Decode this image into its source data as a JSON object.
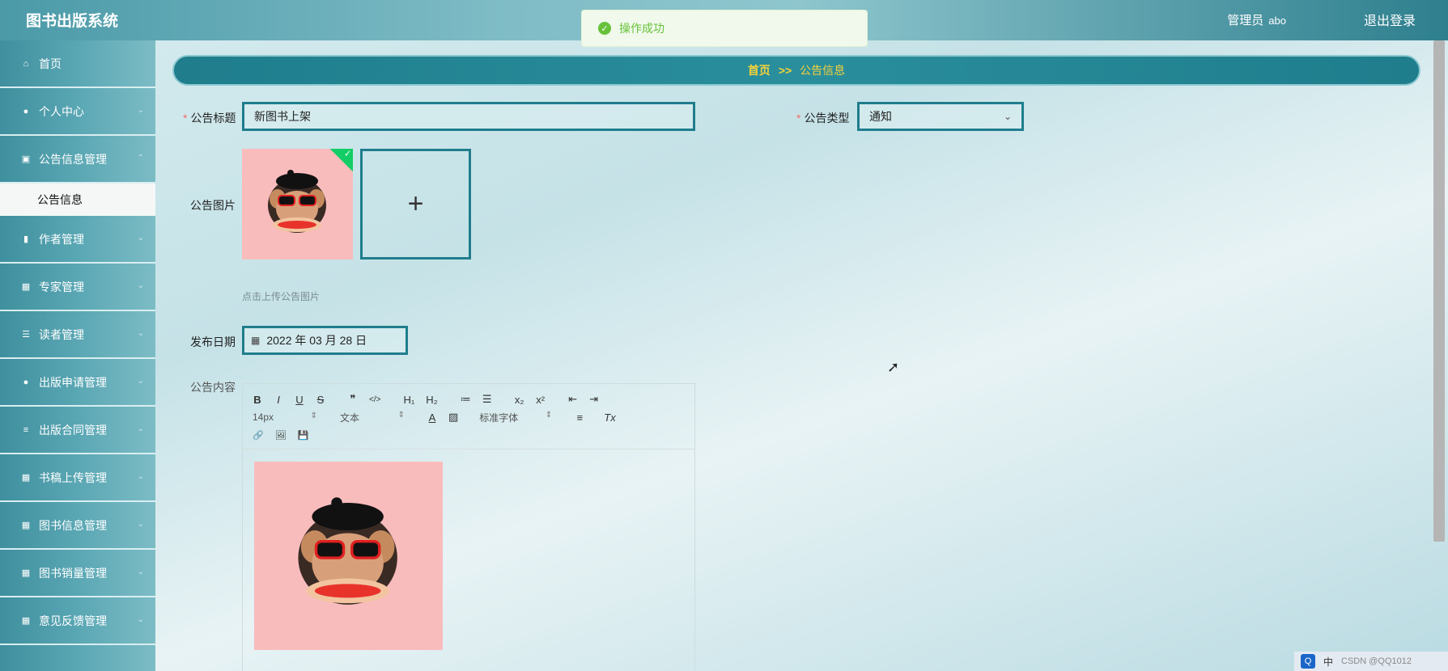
{
  "header": {
    "title": "图书出版系统",
    "user_role": "管理员",
    "user_name": "abo",
    "logout_label": "退出登录"
  },
  "toast": {
    "message": "操作成功"
  },
  "sidebar": {
    "items": [
      {
        "label": "首页",
        "icon": "home-icon"
      },
      {
        "label": "个人中心",
        "icon": "user-icon"
      },
      {
        "label": "公告信息管理",
        "icon": "chart-icon"
      },
      {
        "label": "公告信息",
        "sub": true
      },
      {
        "label": "作者管理",
        "icon": "bar-chart-icon"
      },
      {
        "label": "专家管理",
        "icon": "grid-icon"
      },
      {
        "label": "读者管理",
        "icon": "list-icon"
      },
      {
        "label": "出版申请管理",
        "icon": "user-icon"
      },
      {
        "label": "出版合同管理",
        "icon": "sliders-icon"
      },
      {
        "label": "书稿上传管理",
        "icon": "grid-icon"
      },
      {
        "label": "图书信息管理",
        "icon": "grid-icon"
      },
      {
        "label": "图书销量管理",
        "icon": "grid-icon"
      },
      {
        "label": "意见反馈管理",
        "icon": "grid-icon"
      }
    ]
  },
  "breadcrumb": {
    "home": "首页",
    "separator": ">>",
    "current": "公告信息"
  },
  "form": {
    "title_label": "公告标题",
    "title_value": "新图书上架",
    "type_label": "公告类型",
    "type_value": "通知",
    "image_label": "公告图片",
    "upload_hint": "点击上传公告图片",
    "upload_plus": "+",
    "date_label": "发布日期",
    "date_value": "2022 年 03 月 28 日",
    "content_label": "公告内容"
  },
  "editor": {
    "row1": [
      "B",
      "I",
      "U",
      "S",
      "❞",
      "</>",
      "H₁",
      "H₂",
      "≔",
      "☰",
      "x₂",
      "x²",
      "⇤",
      "⇥"
    ],
    "font_size": "14px",
    "text_style": "文本",
    "font_family": "标准字体",
    "align_icon": "≡",
    "clear_icon": "Tx",
    "row3": [
      "🔗",
      "🖼",
      "💾"
    ]
  },
  "tray": {
    "q": "Q",
    "lang": "中",
    "watermark": "CSDN @QQ1012"
  }
}
